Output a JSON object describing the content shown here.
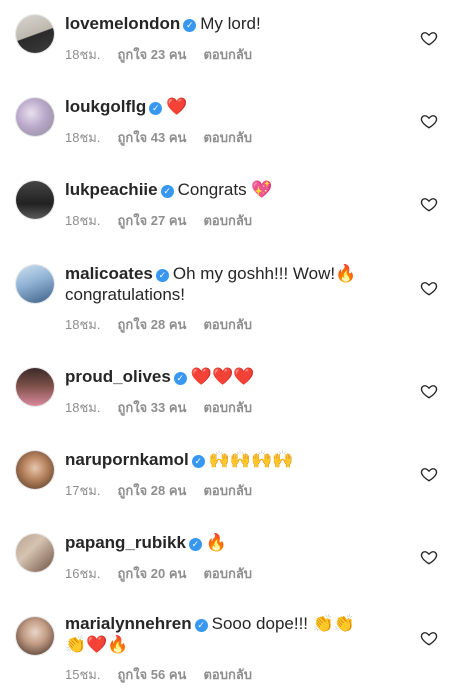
{
  "comments": [
    {
      "user": "lovemelondon",
      "text": "My lord!",
      "line2": "",
      "emoji": "",
      "emoji2": "",
      "time": "18ชม.",
      "likes": "ถูกใจ 23 คน",
      "reply": "ตอบกลับ"
    },
    {
      "user": "loukgolflg",
      "text": "",
      "line2": "",
      "emoji": "❤️",
      "emoji2": "",
      "time": "18ชม.",
      "likes": "ถูกใจ 43 คน",
      "reply": "ตอบกลับ"
    },
    {
      "user": "lukpeachiie",
      "text": "Congrats",
      "line2": "",
      "emoji": "💖",
      "emoji2": "",
      "time": "18ชม.",
      "likes": "ถูกใจ 27 คน",
      "reply": "ตอบกลับ"
    },
    {
      "user": "malicoates",
      "text": "Oh my goshh!!! Wow!",
      "line2": "congratulations!",
      "emoji": "🔥",
      "emoji2": "",
      "time": "18ชม.",
      "likes": "ถูกใจ 28 คน",
      "reply": "ตอบกลับ"
    },
    {
      "user": "proud_olives",
      "text": "",
      "line2": "",
      "emoji": "❤️❤️❤️",
      "emoji2": "",
      "time": "18ชม.",
      "likes": "ถูกใจ 33 คน",
      "reply": "ตอบกลับ"
    },
    {
      "user": "narupornkamol",
      "text": "",
      "line2": "",
      "emoji": "🙌🙌🙌🙌",
      "emoji2": "",
      "time": "17ชม.",
      "likes": "ถูกใจ 28 คน",
      "reply": "ตอบกลับ"
    },
    {
      "user": "papang_rubikk",
      "text": "",
      "line2": "",
      "emoji": "🔥",
      "emoji2": "",
      "time": "16ชม.",
      "likes": "ถูกใจ 20 คน",
      "reply": "ตอบกลับ"
    },
    {
      "user": "marialynnehren",
      "text": "Sooo dope!!!",
      "line2": "",
      "emoji": "👏👏",
      "emoji2": "👏❤️🔥",
      "time": "15ชม.",
      "likes": "ถูกใจ 56 คน",
      "reply": "ตอบกลับ"
    }
  ],
  "colors": {
    "verified": "#3897f0",
    "meta": "#8e8e8e",
    "text": "#262626"
  }
}
